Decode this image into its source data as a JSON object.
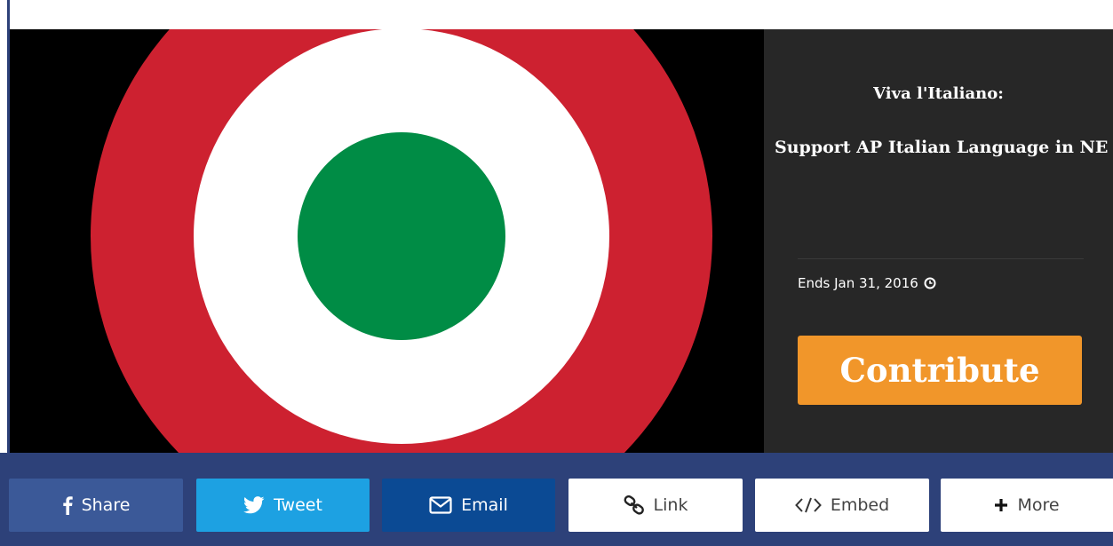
{
  "campaign": {
    "title_line_1": "Viva l'Italiano:",
    "title_line_2": "Support AP Italian Language in NE",
    "ends_text": "Ends Jan 31, 2016",
    "contribute_label": "Contribute"
  },
  "hero": {
    "image": "italian-roundel",
    "colors": {
      "background": "#000000",
      "outer_ring": "#cd2130",
      "middle_ring": "#ffffff",
      "center": "#008c45"
    }
  },
  "share": {
    "buttons": [
      {
        "label": "Share",
        "icon": "facebook-icon",
        "color": "#3b5998"
      },
      {
        "label": "Tweet",
        "icon": "twitter-icon",
        "color": "#1da1e2"
      },
      {
        "label": "Email",
        "icon": "envelope-icon",
        "color": "#0b4a94"
      },
      {
        "label": "Link",
        "icon": "link-icon",
        "color": "#ffffff"
      },
      {
        "label": "Embed",
        "icon": "code-icon",
        "color": "#ffffff"
      },
      {
        "label": "More",
        "icon": "plus-icon",
        "color": "#ffffff"
      }
    ]
  },
  "colors": {
    "accent": "#f1962a",
    "share_bar": "#2d4179",
    "panel": "#272727"
  }
}
